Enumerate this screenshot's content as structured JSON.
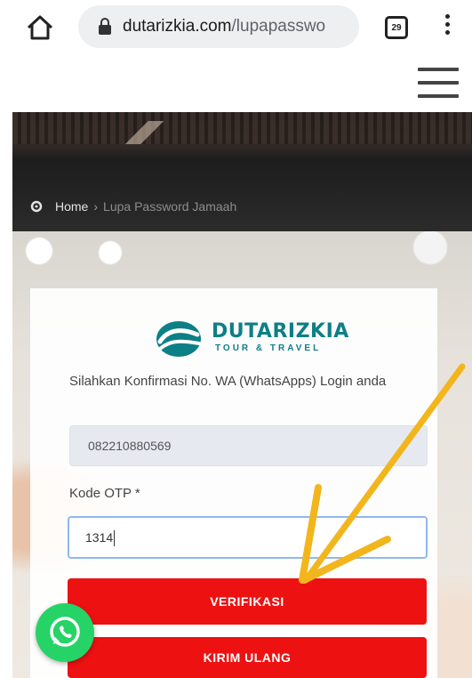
{
  "browser": {
    "url_domain": "dutarizkia.com",
    "url_path": "/lupapasswo",
    "tab_count": "29"
  },
  "breadcrumb": {
    "home": "Home",
    "separator": "›",
    "current": "Lupa Password Jamaah"
  },
  "logo": {
    "name": "DUTARIZKIA",
    "tagline": "TOUR & TRAVEL"
  },
  "form": {
    "instruction": "Silahkan Konfirmasi No. WA (WhatsApps) Login anda",
    "phone_value": "082210880569",
    "otp_label": "Kode OTP *",
    "otp_value": "1314",
    "verify_label": "VERIFIKASI",
    "resend_label": "KIRIM ULANG"
  },
  "colors": {
    "brand_teal": "#0d7f86",
    "button_red": "#ee1111",
    "whatsapp_green": "#25d366",
    "annotation_arrow": "#f2b51c"
  }
}
